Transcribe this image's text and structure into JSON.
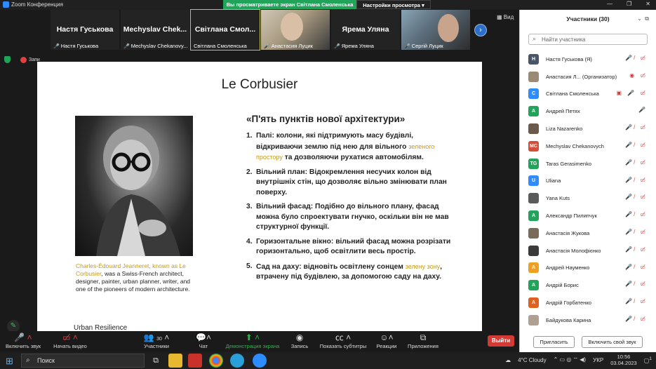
{
  "window": {
    "app_title": "Zoom Конференция"
  },
  "banner": {
    "sharing": "Вы просматриваете экран Світлана Смоленська",
    "view_options": "Настройки просмотра"
  },
  "view_label": "Вид",
  "thumbnails": [
    {
      "big": "Настя Гуськова",
      "small": "Настя Гуськова"
    },
    {
      "big": "Mechyslav  Chek...",
      "small": "Mechyslav Chekanovy..."
    },
    {
      "big": "Світлана Смол...",
      "small": "Світлана Смоленська"
    },
    {
      "big": "",
      "small": "Анастасия Луцик"
    },
    {
      "big": "Ярема Уляна",
      "small": "Ярема Уляна"
    },
    {
      "big": "",
      "small": "Сергій Луцик"
    }
  ],
  "left_icons": {
    "recording": "Запи"
  },
  "slide": {
    "title": "Le Corbusier",
    "caption_highlight": "Charles-Édouard Jeanneret, known as Le Corbusier",
    "caption_rest": ", was a Swiss-French architect, designer, painter, urban planner, writer, and one of the pioneers of modern architecture.",
    "footer": "Urban Resilience",
    "points_title": "«П'ять пунктів нової архітектури»",
    "points": [
      {
        "num": "1.",
        "a": "Палі: колони, які підтримують масу будівлі, відкриваючи землю під нею для вільного ",
        "hl": "зеленого простору",
        "b": " та дозволяючи рухатися автомобілям."
      },
      {
        "num": "2.",
        "a": "Вільний план: Відокремлення несучих колон від внутрішніх стін, що дозволяє вільно змінювати план поверху.",
        "hl": "",
        "b": ""
      },
      {
        "num": "3.",
        "a": "Вільний фасад: Подібно до вільного плану, фасад можна було спроектувати гнучко, оскільки він не мав структурної функції.",
        "hl": "",
        "b": ""
      },
      {
        "num": "4.",
        "a": "Горизонтальне вікно: вільний фасад можна розрізати горизонтально, щоб освітлити весь простір.",
        "hl": "",
        "b": ""
      },
      {
        "num": "5.",
        "a": "Сад на даху: відновіть освітлену сонцем ",
        "hl": "зелену зону",
        "b": ", втрачену під будівлею, за допомогою саду на даху."
      }
    ]
  },
  "toolbar": {
    "audio": "Включить звук",
    "video": "Начать видео",
    "participants": "Участники",
    "participants_count": "30",
    "chat": "Чат",
    "share": "Демонстрация экрана",
    "record": "Запись",
    "captions": "Показать субтитры",
    "reactions": "Реакции",
    "apps": "Приложения",
    "leave": "Выйти"
  },
  "panel": {
    "title": "Участники (30)",
    "search_placeholder": "Найти участника",
    "invite": "Пригласить",
    "unmute": "Включить свой звук",
    "participants": [
      {
        "initials": "Н",
        "name": "Настя Гуськова (Я)",
        "color": "#4a5568",
        "icons": "🎤̸ ▭̸"
      },
      {
        "initials": "",
        "name": "Анастасия Л...  (Организатор)",
        "color": "#9b8a76",
        "icons": "◉ ▭̸"
      },
      {
        "initials": "С",
        "name": "Світлана Смоленська",
        "color": "#2d8cff",
        "icons": "▣ 🎤 ▭̸"
      },
      {
        "initials": "А",
        "name": "Андрей Петях",
        "color": "#22a35a",
        "icons": "🎤"
      },
      {
        "initials": "",
        "name": "Liza Nazarenko",
        "color": "#6b5a4a",
        "icons": "🎤̸ ▭̸"
      },
      {
        "initials": "MC",
        "name": "Mechyslav Chekanovych",
        "color": "#d2503a",
        "icons": "🎤̸ ▭̸"
      },
      {
        "initials": "TG",
        "name": "Taras Gerasimenko",
        "color": "#22a35a",
        "icons": "🎤̸ ▭̸"
      },
      {
        "initials": "U",
        "name": "Uliana",
        "color": "#2d8cff",
        "icons": "🎤̸ ▭̸"
      },
      {
        "initials": "",
        "name": "Yana Kuts",
        "color": "#5a5a5a",
        "icons": "🎤̸ ▭̸"
      },
      {
        "initials": "А",
        "name": "Александр Пилипчук",
        "color": "#22a35a",
        "icons": "🎤̸ ▭̸"
      },
      {
        "initials": "",
        "name": "Анастасія Жукова",
        "color": "#7a6a5a",
        "icons": "🎤̸ ▭̸"
      },
      {
        "initials": "",
        "name": "Анастасія Молофієнко",
        "color": "#3a3a3a",
        "icons": "🎤̸ ▭̸"
      },
      {
        "initials": "А",
        "name": "Андрей Науменко",
        "color": "#f0a020",
        "icons": "🎤̸ ▭̸"
      },
      {
        "initials": "А",
        "name": "Андрій Борис",
        "color": "#22a35a",
        "icons": "🎤̸ ▭̸"
      },
      {
        "initials": "А",
        "name": "Андрій Горбатенко",
        "color": "#e06020",
        "icons": "🎤̸ ▭̸"
      },
      {
        "initials": "",
        "name": "Байдукова Карина",
        "color": "#b0a090",
        "icons": "🎤̸ ▭̸"
      }
    ]
  },
  "taskbar": {
    "search": "Поиск",
    "weather": "4°C  Cloudy",
    "lang": "УКР",
    "time": "10:56",
    "date": "03.04.2023",
    "notif": "1"
  }
}
